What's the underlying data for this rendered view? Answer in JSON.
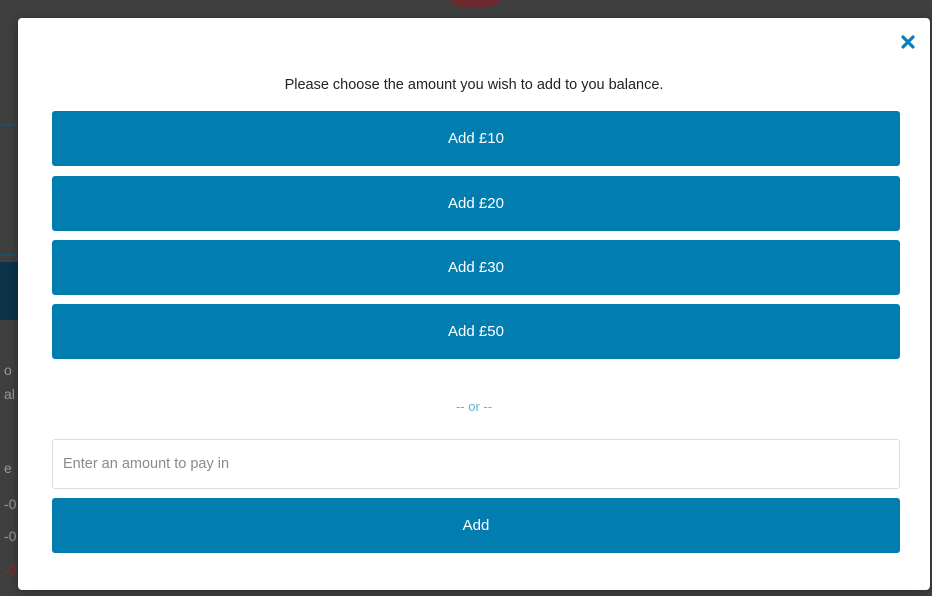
{
  "modal": {
    "prompt": "Please choose the amount you wish to add to you balance.",
    "close_icon": "close-icon",
    "preset_buttons": [
      {
        "label": "Add £10"
      },
      {
        "label": "Add £20"
      },
      {
        "label": "Add £30"
      },
      {
        "label": "Add £50"
      }
    ],
    "separator": "-- or --",
    "custom_amount": {
      "value": "",
      "placeholder": "Enter an amount to pay in"
    },
    "add_button_label": "Add"
  },
  "colors": {
    "button_bg": "#017db0",
    "button_text": "#ffffff",
    "separator_text": "#5fb3d9",
    "close_icon": "#0a7fb5",
    "overlay": "#3f3f3f"
  }
}
